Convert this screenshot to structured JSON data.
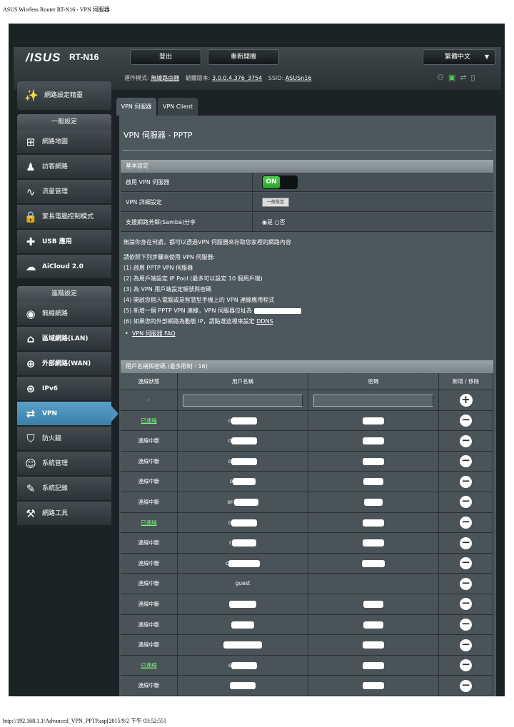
{
  "page_title": "ASUS Wireless Router RT-N16 - VPN 伺服器",
  "footer_url": "http://192.168.1.1/Advanced_VPN_PPTP.asp[2015/9/2 下午 03:52:55]",
  "header": {
    "logo": "/ISUS",
    "model": "RT-N16",
    "logout": "登出",
    "reboot": "重新開機",
    "language": "繁體中文",
    "mode_label": "運作模式:",
    "mode_value": "無線路由器",
    "fw_label": "韌體版本:",
    "fw_value": "3.0.0.4.376_3754",
    "ssid_label": "SSID:",
    "ssid_value": "ASUSn16"
  },
  "sidebar": {
    "quick_setup": "網路設定精靈",
    "general_title": "一般設定",
    "general_items": [
      {
        "label": "網路地圖",
        "icon": "network-map-icon"
      },
      {
        "label": "訪客網路",
        "icon": "guest-network-icon"
      },
      {
        "label": "流量管理",
        "icon": "traffic-icon"
      },
      {
        "label": "家長電腦控制模式",
        "icon": "lock-icon"
      },
      {
        "label": "USB 應用",
        "icon": "usb-puzzle-icon"
      },
      {
        "label": "AiCloud 2.0",
        "icon": "cloud-icon"
      }
    ],
    "advanced_title": "進階設定",
    "advanced_items": [
      {
        "label": "無線網路",
        "icon": "wireless-icon"
      },
      {
        "label": "區域網路(LAN)",
        "icon": "home-icon"
      },
      {
        "label": "外部網路(WAN)",
        "icon": "globe-icon"
      },
      {
        "label": "IPv6",
        "icon": "ipv6-icon"
      },
      {
        "label": "VPN",
        "icon": "vpn-icon"
      },
      {
        "label": "防火牆",
        "icon": "shield-icon"
      },
      {
        "label": "系統管理",
        "icon": "admin-icon"
      },
      {
        "label": "系統記錄",
        "icon": "log-icon"
      },
      {
        "label": "網路工具",
        "icon": "tools-icon"
      }
    ]
  },
  "tabs": [
    "VPN 伺服器",
    "VPN Client"
  ],
  "content": {
    "title": "VPN 伺服器 - PPTP",
    "basic_header": "基本設定",
    "enable_label": "啟用 VPN 伺服器",
    "enable_value": "ON",
    "detail_label": "VPN 詳細設定",
    "detail_value": "一般設定",
    "samba_label": "支援網路芳鄰(Samba)分享",
    "samba_yes": "是",
    "samba_no": "否",
    "desc_lines": [
      "無論你身在何處，都可以透過VPN 伺服器來存取您家裡的網路內容",
      "請依照下列步驟來使用 VPN 伺服器:",
      "(1) 啟用 PPTP VPN 伺服器",
      "(2) 為用戶端設定 IP Pool (最多可以設定 10 個用戶端)",
      "(3) 為 VPN 用戶端設定帳號與密碼",
      "(4) 開啟您個人電腦或是智慧型手機上的 VPN 連線應用程式",
      "(5) 新增一個 PPTP VPN 連線，VPN 伺服器位址為"
    ],
    "ddns_line": "(6) 如果您的外部網路為動態 IP，請點選這裡來設定",
    "ddns_link": "DDNS",
    "faq_link": "VPN 伺服器 FAQ"
  },
  "user_table": {
    "header": "用戶名稱與密碼 (最多限制 : 16)",
    "columns": [
      "連線狀態",
      "用戶名稱",
      "密碼",
      "新增 / 移除"
    ],
    "add_row_status": "-",
    "rows": [
      {
        "status": "已連線",
        "connected": true,
        "user": "o",
        "w1": 36,
        "w2": 30
      },
      {
        "status": "連線中斷",
        "connected": false,
        "user": "o",
        "w1": 36,
        "w2": 30
      },
      {
        "status": "連線中斷",
        "connected": false,
        "user": "o",
        "w1": 36,
        "w2": 30
      },
      {
        "status": "連線中斷",
        "connected": false,
        "user": "o",
        "w1": 32,
        "w2": 28
      },
      {
        "status": "連線中斷",
        "connected": false,
        "user": "on",
        "w1": 34,
        "w2": 26
      },
      {
        "status": "已連線",
        "connected": true,
        "user": "o",
        "w1": 36,
        "w2": 30
      },
      {
        "status": "連線中斷",
        "connected": false,
        "user": "c",
        "w1": 34,
        "w2": 30
      },
      {
        "status": "連線中斷",
        "connected": false,
        "user": "c",
        "w1": 44,
        "w2": 32
      },
      {
        "status": "連線中斷",
        "connected": false,
        "user": "guest",
        "w1": 0,
        "w2": 0
      },
      {
        "status": "連線中斷",
        "connected": false,
        "user": "",
        "w1": 38,
        "w2": 28
      },
      {
        "status": "連線中斷",
        "connected": false,
        "user": "",
        "w1": 32,
        "w2": 28
      },
      {
        "status": "連線中斷",
        "connected": false,
        "user": "",
        "w1": 54,
        "w2": 30
      },
      {
        "status": "已連線",
        "connected": true,
        "user": "s",
        "w1": 36,
        "w2": 30
      },
      {
        "status": "連線中斷",
        "connected": false,
        "user": "",
        "w1": 36,
        "w2": 30
      }
    ]
  }
}
